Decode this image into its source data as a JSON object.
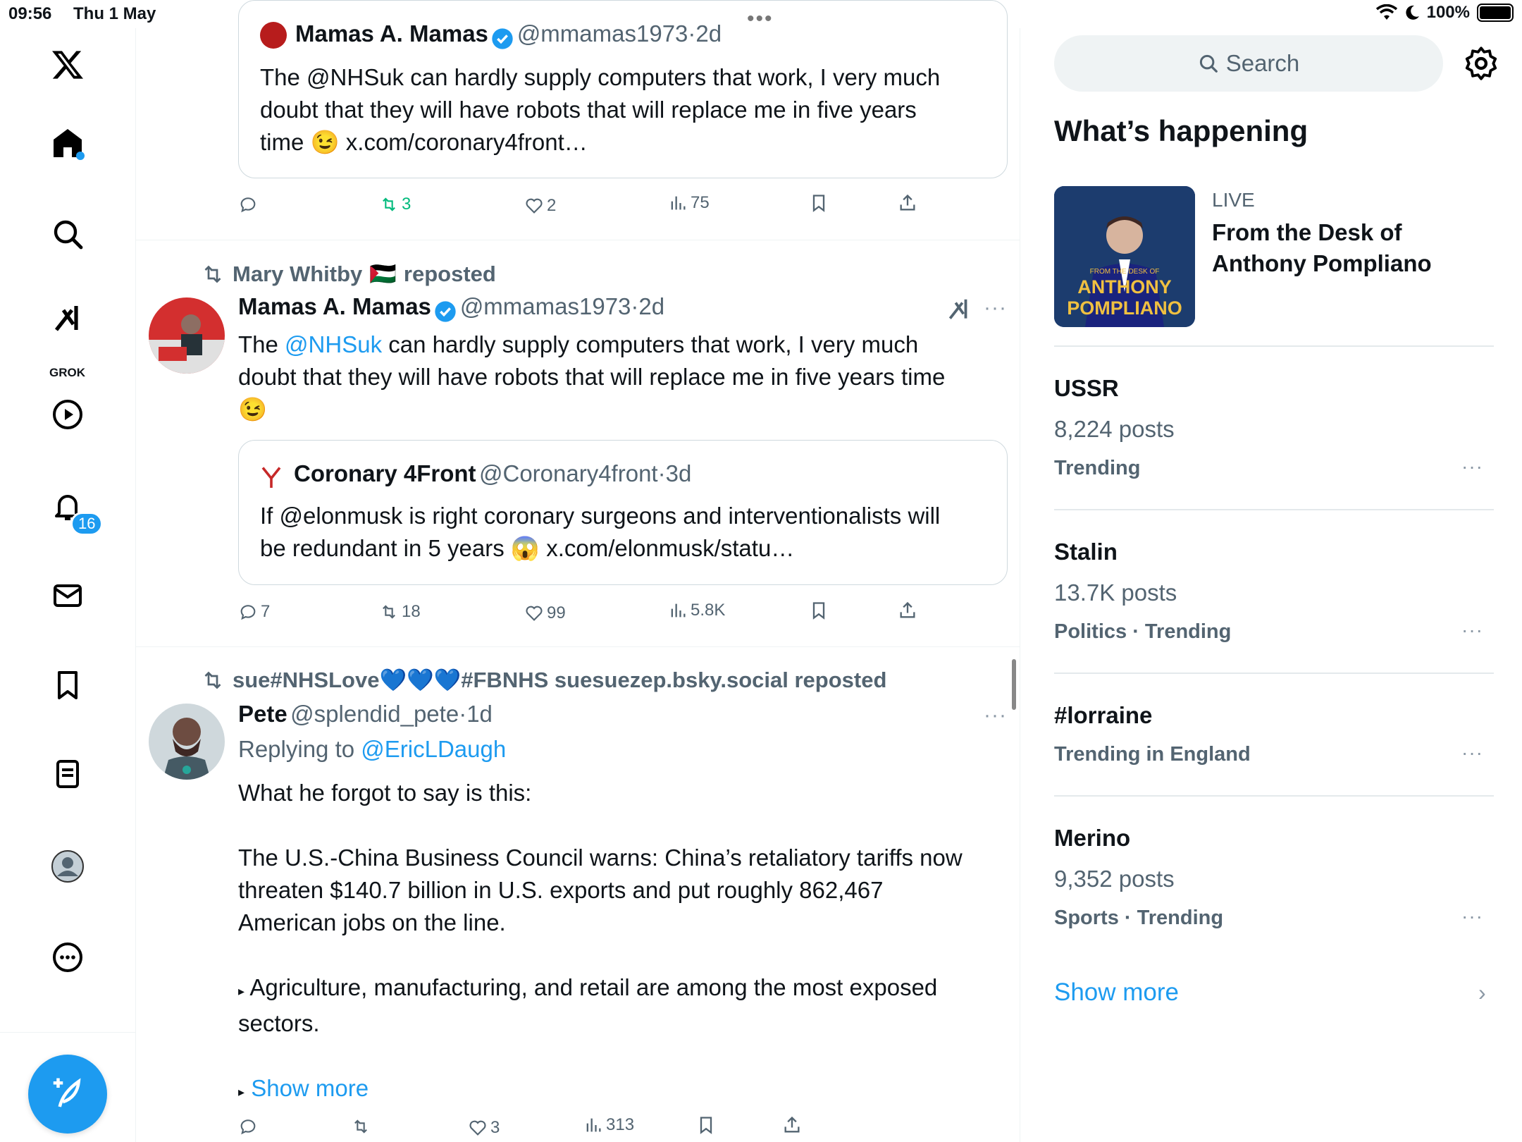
{
  "status_bar": {
    "time": "09:56",
    "date": "Thu 1 May",
    "battery": "100%"
  },
  "nav": {
    "grok_label": "GROK",
    "notifications_count": "16"
  },
  "tweet1_quote": {
    "name": "Mamas A. Mamas",
    "handle": "@mmamas1973",
    "age": "2d",
    "text_line1": "The @NHSuk  can hardly supply computers that work, I very much",
    "text_line2": "doubt that they will have robots that will replace me in five years",
    "text_line3a": "time",
    "text_line3b": "x.com/coronary4front…",
    "emoji": "😉",
    "replies": "",
    "reposts": "3",
    "likes": "2",
    "views": "75"
  },
  "tweet2": {
    "reposted_by": "Mary Whitby",
    "reposted_flag": "🇵🇸",
    "reposted_suffix": "reposted",
    "name": "Mamas A. Mamas",
    "handle": "@mmamas1973",
    "age": "2d",
    "text_a": "The ",
    "mention": "@NHSuk",
    "text_b": "  can hardly supply computers that work, I very much",
    "text_line2": "doubt that they will have robots that will replace me in five years time",
    "emoji": "😉",
    "quote": {
      "name": "Coronary 4Front",
      "handle": "@Coronary4front",
      "age": "3d",
      "text_line1": "If @elonmusk is right coronary surgeons and interventionalists will",
      "text_line2a": "be redundant in 5 years",
      "emoji": "😱",
      "text_line2b": "x.com/elonmusk/statu…"
    },
    "replies": "7",
    "reposts": "18",
    "likes": "99",
    "views": "5.8K"
  },
  "tweet3": {
    "reposted_by": "sue#NHSLove💙💙💙#FBNHS suesuezep.bsky.social reposted",
    "name": "Pete",
    "handle": "@splendid_pete",
    "age": "1d",
    "replying_to_label": "Replying to",
    "replying_to": "@EricLDaugh",
    "p1": "What he forgot to say is this:",
    "p2_l1": "The U.S.-China Business Council warns: China’s retaliatory tariffs now",
    "p2_l2": "threaten $140.7 billion in U.S. exports and put roughly 862,467",
    "p2_l3": "American jobs on the line.",
    "p3_l1": "Agriculture, manufacturing, and retail are among the most exposed",
    "p3_l2": "sectors.",
    "show_more": "Show more",
    "replies": "",
    "reposts": "",
    "likes": "3",
    "views": "313"
  },
  "right": {
    "search_placeholder": "Search",
    "whats_happening": "What’s happening",
    "live_label": "LIVE",
    "live_title": "From the Desk of Anthony Pompliano",
    "live_thumb_small": "FROM THE DESK OF",
    "live_thumb_big1": "ANTHONY",
    "live_thumb_big2": "POMPLIANO",
    "trends": [
      {
        "name": "USSR",
        "count": "8,224 posts",
        "category": "Trending"
      },
      {
        "name": "Stalin",
        "count": "13.7K posts",
        "category": "Politics · Trending"
      },
      {
        "name": "#lorraine",
        "count": "",
        "category": "Trending in England"
      },
      {
        "name": "Merino",
        "count": "9,352 posts",
        "category": "Sports · Trending"
      }
    ],
    "show_more": "Show more"
  },
  "colors": {
    "accent": "#1d9bf0",
    "secondary_text": "#536471",
    "repost_green": "#00ba7c"
  }
}
